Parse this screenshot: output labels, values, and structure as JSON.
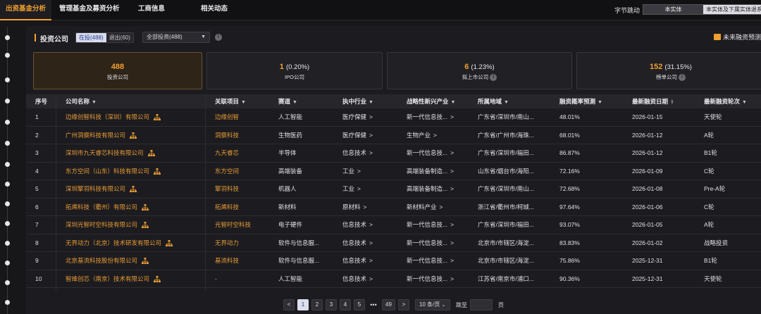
{
  "tabs": [
    {
      "label": "出资基金分析",
      "active": true
    },
    {
      "label": "管理基金及募资分析",
      "active": false
    },
    {
      "label": "工商信息",
      "active": false
    },
    {
      "label": "相关动态",
      "active": false
    }
  ],
  "header": {
    "company_label": "字节跳动",
    "entity_toggle": {
      "option1": "本实体",
      "option2": "本实体及下属实体退系"
    }
  },
  "section": {
    "title": "投资公司",
    "filter_on": "在投(488)",
    "filter_off": "退出(60)",
    "dropdown_value": "全部投资(488)",
    "future_label": "未来融资预测"
  },
  "stats": [
    {
      "value": "488",
      "pct": "",
      "label": "投资公司"
    },
    {
      "value": "1",
      "pct": "(0.20%)",
      "label": "IPO公司"
    },
    {
      "value": "6",
      "pct": "(1.23%)",
      "label": "拟上市公司"
    },
    {
      "value": "152",
      "pct": "(31.15%)",
      "label": "榜单公司"
    }
  ],
  "table": {
    "headers": [
      "序号",
      "公司名称",
      "关联项目",
      "赛道",
      "执中行业",
      "战略性新兴产业",
      "所属地域",
      "融资概率预测",
      "最新融资日期",
      "最新融资轮次"
    ],
    "rows": [
      {
        "no": "1",
        "company": "边缘创智科技（深圳）有限公司",
        "project": "边缘创智",
        "track": "人工智能",
        "industry": "医疗保健",
        "strategic": "新一代信息技...",
        "region": "广东省/深圳市/南山...",
        "prob": "48.01%",
        "date": "2026-01-15",
        "round": "天使轮"
      },
      {
        "no": "2",
        "company": "广州洞察科技有限公司",
        "project": "洞察科技",
        "track": "生物医药",
        "industry": "医疗保健",
        "strategic": "生物产业",
        "region": "广东省/广州市/海珠...",
        "prob": "68.01%",
        "date": "2026-01-12",
        "round": "A轮"
      },
      {
        "no": "3",
        "company": "深圳市九天睿芯科技有限公司",
        "project": "九天睿芯",
        "track": "半导体",
        "industry": "信息技术",
        "strategic": "新一代信息技...",
        "region": "广东省/深圳市/福田...",
        "prob": "86.87%",
        "date": "2026-01-12",
        "round": "B1轮"
      },
      {
        "no": "4",
        "company": "东方空间（山东）科技有限公司",
        "project": "东方空间",
        "track": "高端装备",
        "industry": "工业",
        "strategic": "高端装备制造...",
        "region": "山东省/烟台市/海阳...",
        "prob": "72.16%",
        "date": "2026-01-09",
        "round": "C轮"
      },
      {
        "no": "5",
        "company": "深圳擎羽科技有限公司",
        "project": "擎羽科技",
        "track": "机器人",
        "industry": "工业",
        "strategic": "高端装备制造...",
        "region": "广东省/深圳市/南山...",
        "prob": "72.68%",
        "date": "2026-01-08",
        "round": "Pre-A轮"
      },
      {
        "no": "6",
        "company": "拓烯科技（衢州）有限公司",
        "project": "拓烯科技",
        "track": "新材料",
        "industry": "原材料",
        "strategic": "新材料产业",
        "region": "浙江省/衢州市/柯城...",
        "prob": "97.64%",
        "date": "2026-01-06",
        "round": "C轮"
      },
      {
        "no": "7",
        "company": "深圳光智时空科技有限公司",
        "project": "光智时空科技",
        "track": "电子硬件",
        "industry": "信息技术",
        "strategic": "新一代信息技...",
        "region": "广东省/深圳市/福田...",
        "prob": "93.07%",
        "date": "2026-01-05",
        "round": "A轮"
      },
      {
        "no": "8",
        "company": "无界动力（北京）技术研发有限公司",
        "project": "无界动力",
        "track": "软件与信息服...",
        "industry": "信息技术",
        "strategic": "新一代信息技...",
        "region": "北京市/市辖区/海淀...",
        "prob": "83.83%",
        "date": "2026-01-02",
        "round": "战略投资"
      },
      {
        "no": "9",
        "company": "北京基流科技股份有限公司",
        "project": "基流科技",
        "track": "软件与信息服...",
        "industry": "信息技术",
        "strategic": "新一代信息技...",
        "region": "北京市/市辖区/海淀...",
        "prob": "75.86%",
        "date": "2025-12-31",
        "round": "B1轮"
      },
      {
        "no": "10",
        "company": "智维创芯（南京）技术有限公司",
        "project": "-",
        "track": "人工智能",
        "industry": "信息技术",
        "strategic": "新一代信息技...",
        "region": "江苏省/南京市/浦口...",
        "prob": "90.36%",
        "date": "2025-12-31",
        "round": "天使轮"
      }
    ]
  },
  "pagination": {
    "prev": "<",
    "pages": [
      "1",
      "2",
      "3",
      "4",
      "5"
    ],
    "ellipsis": "•••",
    "last": "49",
    "next": ">",
    "page_size": "10 条/页",
    "jump_label": "跳至",
    "page_suffix": "页"
  },
  "colors": {
    "accent": "#f0a030",
    "bg": "#17171a",
    "panel": "#1c1c20"
  },
  "icons": [
    "filter-icon",
    "sort-icon",
    "org-chart-icon",
    "info-icon",
    "chevron-right-icon",
    "forecast-icon"
  ]
}
